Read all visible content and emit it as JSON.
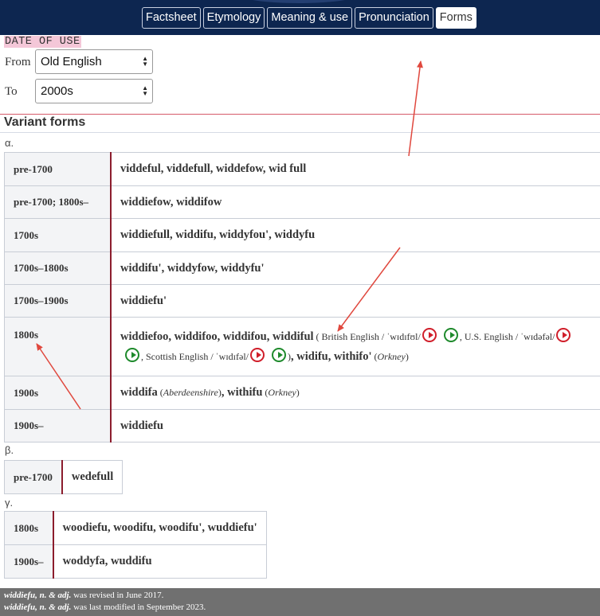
{
  "nav": {
    "tabs": [
      {
        "label": "Factsheet",
        "active": false
      },
      {
        "label": "Etymology",
        "active": false
      },
      {
        "label": "Meaning & use",
        "active": false
      },
      {
        "label": "Pronunciation",
        "active": false
      },
      {
        "label": "Forms",
        "active": true
      }
    ]
  },
  "date_filter": {
    "title": "DATE OF USE",
    "from_label": "From",
    "from_value": "Old English",
    "to_label": "To",
    "to_value": "2000s"
  },
  "variant_forms": {
    "heading": "Variant forms",
    "alpha": {
      "label": "α.",
      "rows": [
        {
          "date": "pre-1700",
          "forms": "viddeful, viddefull, widdefow, wid full"
        },
        {
          "date": "pre-1700; 1800s–",
          "forms": "widdiefow, widdifow"
        },
        {
          "date": "1700s",
          "forms": "widdiefull, widdifu, widdyfou', widdyfu"
        },
        {
          "date": "1700s–1800s",
          "forms": "widdifu', widdyfow, widdyfu'"
        },
        {
          "date": "1700s–1900s",
          "forms": "widdiefu'"
        },
        {
          "date": "1800s",
          "forms_main": "widdiefoo, widdifoo, widdifou, widdiful",
          "paren_open": " ( ",
          "british_label": "British English",
          "british_ipa": " / ˈwɪdɪfʊl/",
          "us_label": ", U.S. English",
          "us_ipa": " / ˈwɪdəfəl/",
          "scottish_label": ", Scottish English",
          "scottish_ipa": " / ˈwɪdɪfəl/",
          "paren_close": ")",
          "forms_tail": ", widifu, withifo'",
          "tail_note_open": " (",
          "tail_note": "Orkney",
          "tail_note_close": ")"
        },
        {
          "date": "1900s",
          "form1": "widdifa",
          "note1_open": " (",
          "note1": "Aberdeenshire",
          "note1_close": ")",
          "sep": ", ",
          "form2": "withifu",
          "note2_open": " (",
          "note2": "Orkney",
          "note2_close": ")"
        },
        {
          "date": "1900s–",
          "forms": "widdiefu"
        }
      ]
    },
    "beta": {
      "label": "β.",
      "rows": [
        {
          "date": "pre-1700",
          "forms": "wedefull"
        }
      ]
    },
    "gamma": {
      "label": "γ.",
      "rows": [
        {
          "date": "1800s",
          "forms": "woodiefu, woodifu, woodifu', wuddiefu'"
        },
        {
          "date": "1900s–",
          "forms": "woddyfa, wuddifu"
        }
      ]
    }
  },
  "footer": {
    "line1_entry": "widdiefu, n. & adj.",
    "line1_text": " was revised in June 2017.",
    "line2_entry": "widdiefu, n. & adj.",
    "line2_text": " was last modified in September 2023."
  },
  "icons": {
    "play_red_color": "#d01e2a",
    "play_green_color": "#1e8a2c",
    "arrow_color": "#e0483e"
  }
}
